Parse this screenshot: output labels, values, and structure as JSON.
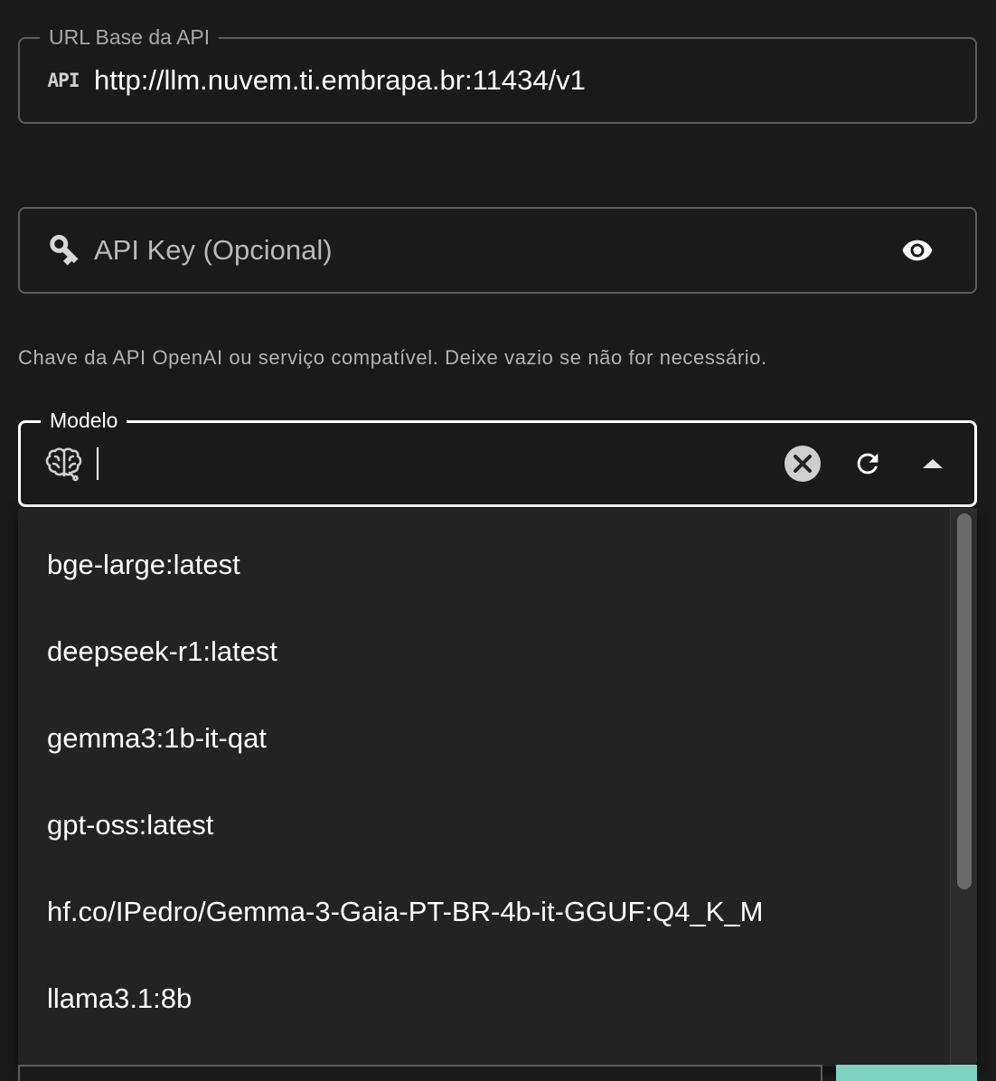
{
  "url_field": {
    "label": "URL Base da API",
    "icon": "api-icon",
    "icon_text": "API",
    "value": "http://llm.nuvem.ti.embrapa.br:11434/v1"
  },
  "key_field": {
    "icon": "key-icon",
    "placeholder": "API Key (Opcional)",
    "toggle_icon": "eye-icon"
  },
  "helper_text": "Chave da API OpenAI ou serviço compatível. Deixe vazio se não for necessário.",
  "model_field": {
    "label": "Modelo",
    "icon": "brain-icon",
    "value": "",
    "actions": [
      "clear-icon",
      "refresh-icon",
      "arrow-up-icon"
    ]
  },
  "model_options": [
    "bge-large:latest",
    "deepseek-r1:latest",
    "gemma3:1b-it-qat",
    "gpt-oss:latest",
    "hf.co/IPedro/Gemma-3-Gaia-PT-BR-4b-it-GGUF:Q4_K_M",
    "llama3.1:8b"
  ],
  "colors": {
    "background": "#1a1a1a",
    "dropdown": "#232323",
    "accent": "#7fd1c0",
    "border": "#5c5c5c",
    "focused_border": "#ffffff"
  }
}
